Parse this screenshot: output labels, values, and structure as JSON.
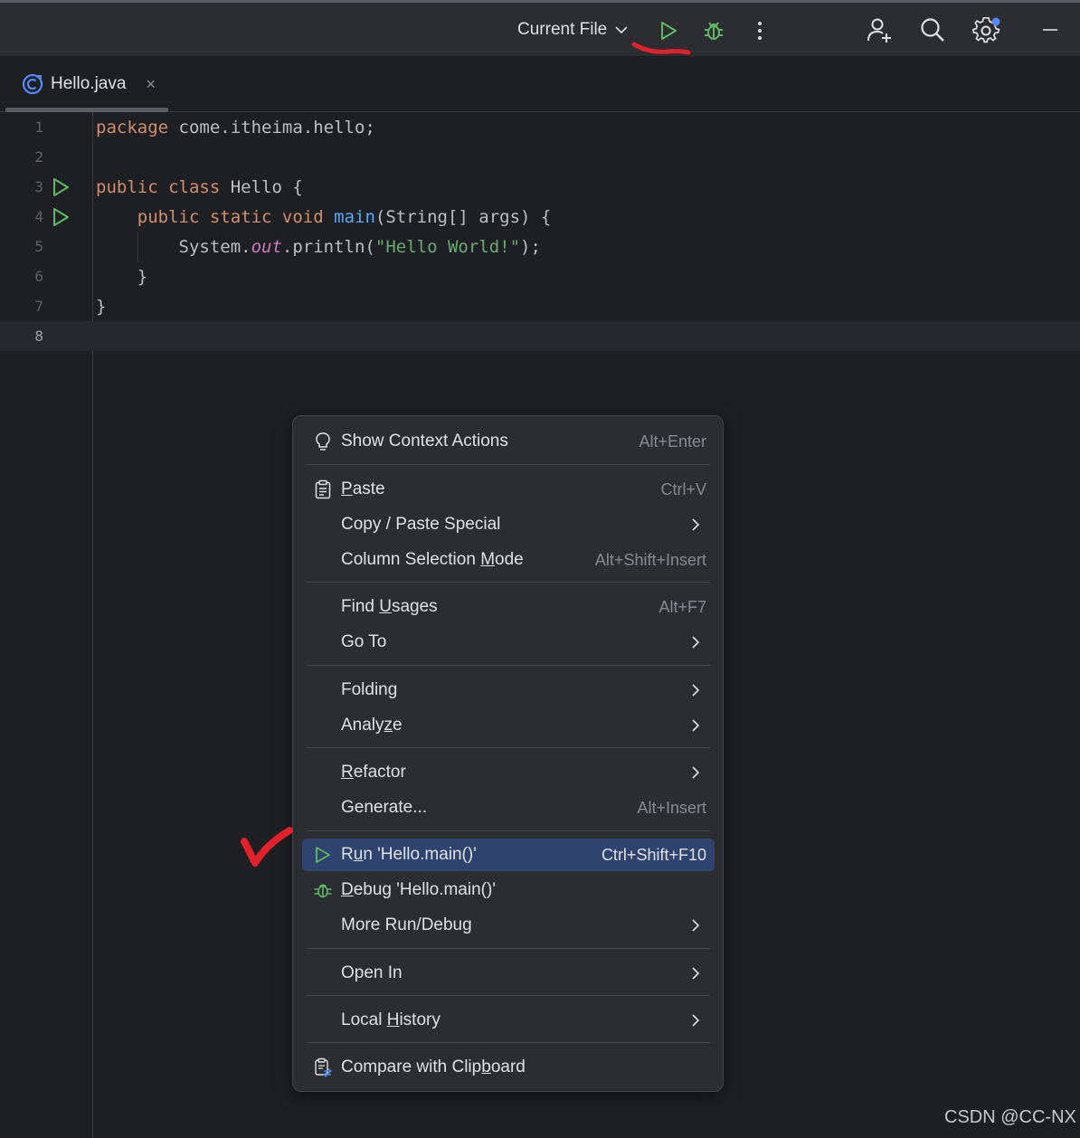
{
  "toolbar": {
    "run_config_label": "Current File",
    "icons": [
      "chevron-down-icon",
      "run-icon",
      "debug-bug-icon",
      "more-vertical-icon",
      "add-user-icon",
      "search-icon",
      "settings-gear-icon",
      "minimize-icon"
    ],
    "colors": {
      "run_green": "#5fb865",
      "annotation_red": "#e0212b",
      "notification_blue": "#548af7"
    }
  },
  "tabs": [
    {
      "label": "Hello.java",
      "close": "×",
      "icon": "java-class-icon"
    }
  ],
  "editor": {
    "line_numbers": [
      "1",
      "2",
      "3",
      "4",
      "5",
      "6",
      "7",
      "8"
    ],
    "current_line": 8,
    "run_gutter_lines": [
      3,
      4
    ],
    "tokens": {
      "l1_kw": "package",
      "l1_rest": " come.itheima.hello;",
      "l3_kw": "public class",
      "l3_rest": " Hello {",
      "l4_indent": "    ",
      "l4_kw": "public static void",
      "l4_sp": " ",
      "l4_fn": "main",
      "l4_rest": "(String[] args) {",
      "l5_pre": "        System.",
      "l5_field": "out",
      "l5_mid": ".println(",
      "l5_str": "\"Hello World!\"",
      "l5_end": ");",
      "l6": "    }",
      "l7": "}"
    }
  },
  "context_menu": {
    "items": {
      "show_context_actions": {
        "label": "Show Context Actions",
        "shortcut": "Alt+Enter",
        "icon": "lightbulb-icon"
      },
      "paste": {
        "label_pre": "",
        "label_u": "P",
        "label_post": "aste",
        "shortcut": "Ctrl+V",
        "icon": "clipboard-icon"
      },
      "copy_paste_special": {
        "label": "Copy / Paste Special"
      },
      "column_selection_mode": {
        "label_pre": "Column Selection ",
        "label_u": "M",
        "label_post": "ode",
        "shortcut": "Alt+Shift+Insert"
      },
      "find_usages": {
        "label_pre": "Find ",
        "label_u": "U",
        "label_post": "sages",
        "shortcut": "Alt+F7"
      },
      "go_to": {
        "label": "Go To"
      },
      "folding": {
        "label": "Folding"
      },
      "analyze": {
        "label_pre": "Analy",
        "label_u": "z",
        "label_post": "e"
      },
      "refactor": {
        "label_pre": "",
        "label_u": "R",
        "label_post": "efactor"
      },
      "generate": {
        "label": "Generate...",
        "shortcut": "Alt+Insert"
      },
      "run": {
        "label_pre": "R",
        "label_u": "u",
        "label_post": "n 'Hello.main()'",
        "shortcut": "Ctrl+Shift+F10",
        "icon": "run-icon"
      },
      "debug": {
        "label_pre": "",
        "label_u": "D",
        "label_post": "ebug 'Hello.main()'",
        "icon": "debug-bug-icon"
      },
      "more_run_debug": {
        "label": "More Run/Debug"
      },
      "open_in": {
        "label": "Open In"
      },
      "local_history": {
        "label_pre": "Local ",
        "label_u": "H",
        "label_post": "istory"
      },
      "compare_clipboard": {
        "label_pre": "Compare with Clip",
        "label_u": "b",
        "label_post": "oard",
        "icon": "compare-clipboard-icon"
      }
    },
    "selected_item": "run",
    "colors": {
      "selected_bg": "#2e436e",
      "menu_bg": "#2b2d30"
    }
  },
  "watermark": "CSDN @CC-NX"
}
